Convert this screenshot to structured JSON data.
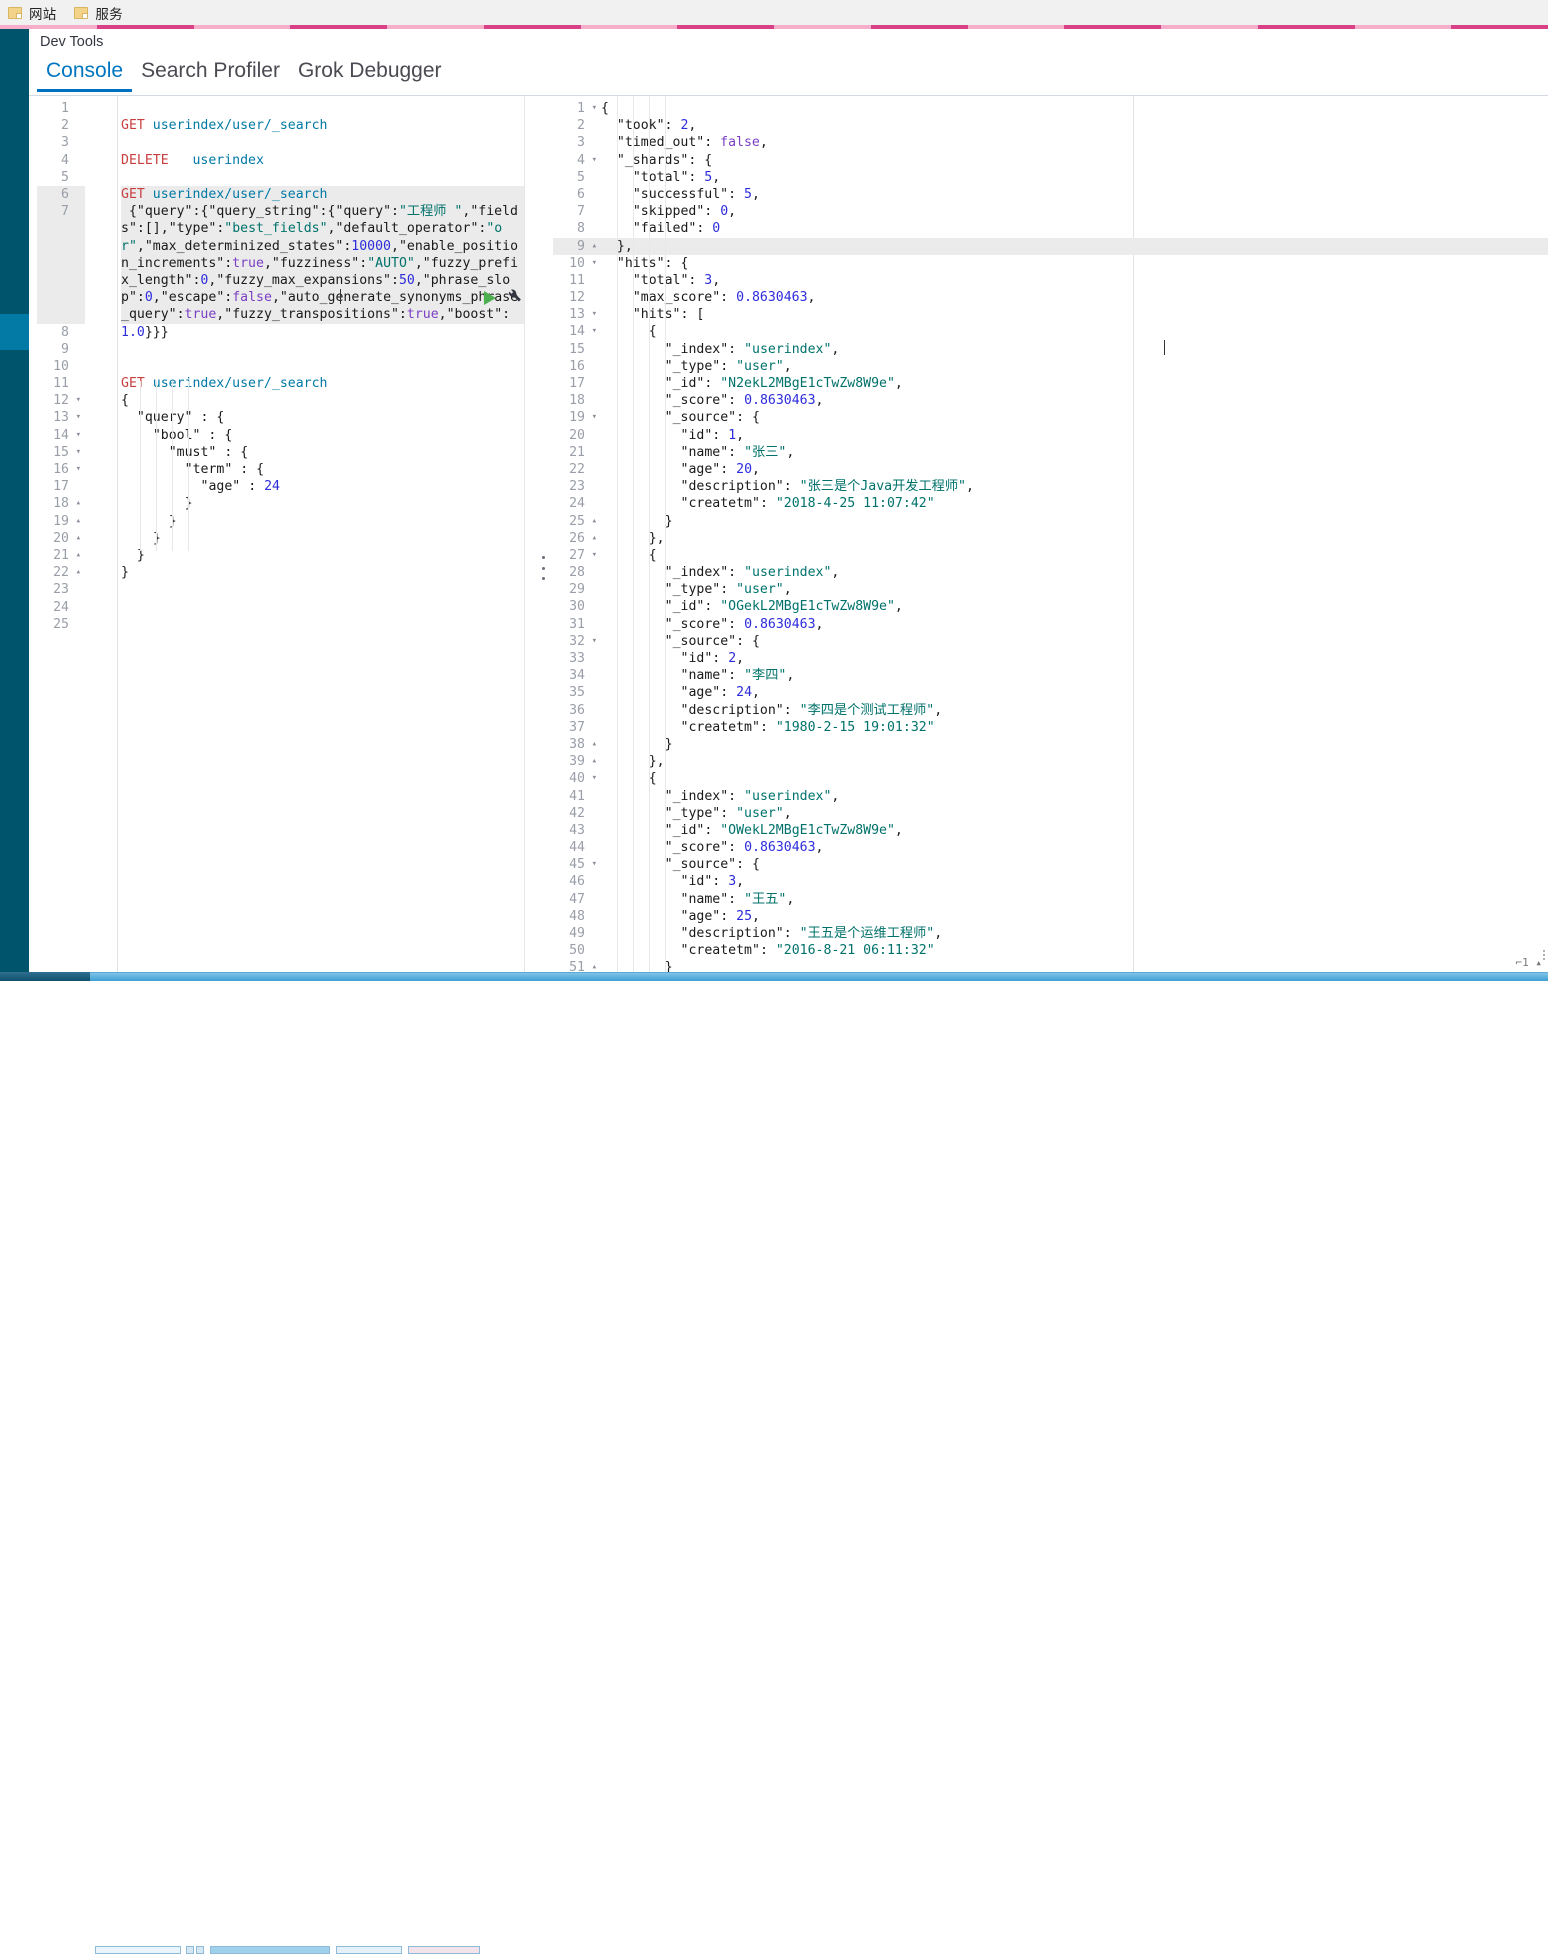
{
  "browser": {
    "bookmarks": [
      {
        "icon": "folder-icon",
        "label": "网站"
      },
      {
        "icon": "folder-icon",
        "label": "服务"
      }
    ]
  },
  "loading_bar": {
    "color_dark": "#d94186",
    "color_light": "#f6aecb",
    "segment_count": 16
  },
  "app": {
    "title": "Dev Tools",
    "tabs": [
      {
        "label": "Console",
        "active": true
      },
      {
        "label": "Search Profiler",
        "active": false
      },
      {
        "label": "Grok Debugger",
        "active": false
      }
    ],
    "accent_color": "#0071c2",
    "nav_color": "#00546b",
    "nav_active_color": "#0379a6"
  },
  "request_actions": {
    "play_label": "play-icon",
    "wrench_label": "wrench-icon"
  },
  "editor": {
    "request": {
      "total_lines": 25,
      "lines": [
        {
          "n": 1,
          "fold": "",
          "text": ""
        },
        {
          "n": 2,
          "fold": "",
          "text": "GET userindex/user/_search",
          "type": "method"
        },
        {
          "n": 3,
          "fold": "",
          "text": ""
        },
        {
          "n": 4,
          "fold": "",
          "text": "DELETE   userindex",
          "type": "method"
        },
        {
          "n": 5,
          "fold": "",
          "text": ""
        },
        {
          "n": 6,
          "fold": "",
          "text": "GET userindex/user/_search",
          "type": "method",
          "highlight": true
        },
        {
          "n": 7,
          "fold": "",
          "text": "{\"query\":{\"query_string\":{\"query\":\"工程师 \",\"fields\":[],\"type\":\"best_fields\",\"default_operator\":\"or\",\"max_determinized_states\":10000,\"enable_position_increments\":true,\"fuzziness\":\"AUTO\",\"fuzzy_prefix_length\":0,\"fuzzy_max_expansions\":50,\"phrase_slop\":0,\"escape\":false,\"auto_generate_synonyms_phrase_query\":true,\"fuzzy_transpositions\":true,\"boost\":1.0}}}",
          "type": "body",
          "highlight": true
        },
        {
          "n": 8,
          "fold": "",
          "text": ""
        },
        {
          "n": 9,
          "fold": "",
          "text": ""
        },
        {
          "n": 10,
          "fold": "",
          "text": ""
        },
        {
          "n": 11,
          "fold": "",
          "text": "GET userindex/user/_search",
          "type": "method"
        },
        {
          "n": 12,
          "fold": "▾",
          "text": "{"
        },
        {
          "n": 13,
          "fold": "▾",
          "text": "  \"query\" : {"
        },
        {
          "n": 14,
          "fold": "▾",
          "text": "    \"bool\" : {"
        },
        {
          "n": 15,
          "fold": "▾",
          "text": "      \"must\" : {"
        },
        {
          "n": 16,
          "fold": "▾",
          "text": "        \"term\" : {"
        },
        {
          "n": 17,
          "fold": "",
          "text": "          \"age\" : 24"
        },
        {
          "n": 18,
          "fold": "▴",
          "text": "        }"
        },
        {
          "n": 19,
          "fold": "▴",
          "text": "      }"
        },
        {
          "n": 20,
          "fold": "▴",
          "text": "    }"
        },
        {
          "n": 21,
          "fold": "▴",
          "text": "  }"
        },
        {
          "n": 22,
          "fold": "▴",
          "text": "}"
        },
        {
          "n": 23,
          "fold": "",
          "text": ""
        },
        {
          "n": 24,
          "fold": "",
          "text": ""
        },
        {
          "n": 25,
          "fold": "",
          "text": ""
        }
      ]
    },
    "response": {
      "highlighted_line": 9,
      "lines": [
        {
          "n": 1,
          "fold": "▾",
          "text": "{"
        },
        {
          "n": 2,
          "fold": "",
          "text": "  \"took\": 2,"
        },
        {
          "n": 3,
          "fold": "",
          "text": "  \"timed_out\": false,"
        },
        {
          "n": 4,
          "fold": "▾",
          "text": "  \"_shards\": {"
        },
        {
          "n": 5,
          "fold": "",
          "text": "    \"total\": 5,"
        },
        {
          "n": 6,
          "fold": "",
          "text": "    \"successful\": 5,"
        },
        {
          "n": 7,
          "fold": "",
          "text": "    \"skipped\": 0,"
        },
        {
          "n": 8,
          "fold": "",
          "text": "    \"failed\": 0"
        },
        {
          "n": 9,
          "fold": "▴",
          "text": "  },"
        },
        {
          "n": 10,
          "fold": "▾",
          "text": "  \"hits\": {"
        },
        {
          "n": 11,
          "fold": "",
          "text": "    \"total\": 3,"
        },
        {
          "n": 12,
          "fold": "",
          "text": "    \"max_score\": 0.8630463,"
        },
        {
          "n": 13,
          "fold": "▾",
          "text": "    \"hits\": ["
        },
        {
          "n": 14,
          "fold": "▾",
          "text": "      {"
        },
        {
          "n": 15,
          "fold": "",
          "text": "        \"_index\": \"userindex\","
        },
        {
          "n": 16,
          "fold": "",
          "text": "        \"_type\": \"user\","
        },
        {
          "n": 17,
          "fold": "",
          "text": "        \"_id\": \"N2ekL2MBgE1cTwZw8W9e\","
        },
        {
          "n": 18,
          "fold": "",
          "text": "        \"_score\": 0.8630463,"
        },
        {
          "n": 19,
          "fold": "▾",
          "text": "        \"_source\": {"
        },
        {
          "n": 20,
          "fold": "",
          "text": "          \"id\": 1,"
        },
        {
          "n": 21,
          "fold": "",
          "text": "          \"name\": \"张三\","
        },
        {
          "n": 22,
          "fold": "",
          "text": "          \"age\": 20,"
        },
        {
          "n": 23,
          "fold": "",
          "text": "          \"description\": \"张三是个Java开发工程师\","
        },
        {
          "n": 24,
          "fold": "",
          "text": "          \"createtm\": \"2018-4-25 11:07:42\""
        },
        {
          "n": 25,
          "fold": "▴",
          "text": "        }"
        },
        {
          "n": 26,
          "fold": "▴",
          "text": "      },"
        },
        {
          "n": 27,
          "fold": "▾",
          "text": "      {"
        },
        {
          "n": 28,
          "fold": "",
          "text": "        \"_index\": \"userindex\","
        },
        {
          "n": 29,
          "fold": "",
          "text": "        \"_type\": \"user\","
        },
        {
          "n": 30,
          "fold": "",
          "text": "        \"_id\": \"OGekL2MBgE1cTwZw8W9e\","
        },
        {
          "n": 31,
          "fold": "",
          "text": "        \"_score\": 0.8630463,"
        },
        {
          "n": 32,
          "fold": "▾",
          "text": "        \"_source\": {"
        },
        {
          "n": 33,
          "fold": "",
          "text": "          \"id\": 2,"
        },
        {
          "n": 34,
          "fold": "",
          "text": "          \"name\": \"李四\","
        },
        {
          "n": 35,
          "fold": "",
          "text": "          \"age\": 24,"
        },
        {
          "n": 36,
          "fold": "",
          "text": "          \"description\": \"李四是个测试工程师\","
        },
        {
          "n": 37,
          "fold": "",
          "text": "          \"createtm\": \"1980-2-15 19:01:32\""
        },
        {
          "n": 38,
          "fold": "▴",
          "text": "        }"
        },
        {
          "n": 39,
          "fold": "▴",
          "text": "      },"
        },
        {
          "n": 40,
          "fold": "▾",
          "text": "      {"
        },
        {
          "n": 41,
          "fold": "",
          "text": "        \"_index\": \"userindex\","
        },
        {
          "n": 42,
          "fold": "",
          "text": "        \"_type\": \"user\","
        },
        {
          "n": 43,
          "fold": "",
          "text": "        \"_id\": \"OWekL2MBgE1cTwZw8W9e\","
        },
        {
          "n": 44,
          "fold": "",
          "text": "        \"_score\": 0.8630463,"
        },
        {
          "n": 45,
          "fold": "▾",
          "text": "        \"_source\": {"
        },
        {
          "n": 46,
          "fold": "",
          "text": "          \"id\": 3,"
        },
        {
          "n": 47,
          "fold": "",
          "text": "          \"name\": \"王五\","
        },
        {
          "n": 48,
          "fold": "",
          "text": "          \"age\": 25,"
        },
        {
          "n": 49,
          "fold": "",
          "text": "          \"description\": \"王五是个运维工程师\","
        },
        {
          "n": 50,
          "fold": "",
          "text": "          \"createtm\": \"2016-8-21 06:11:32\""
        },
        {
          "n": 51,
          "fold": "▴",
          "text": "        }"
        }
      ]
    }
  },
  "status_bar": {
    "right_text": "⌐1 ▴"
  }
}
